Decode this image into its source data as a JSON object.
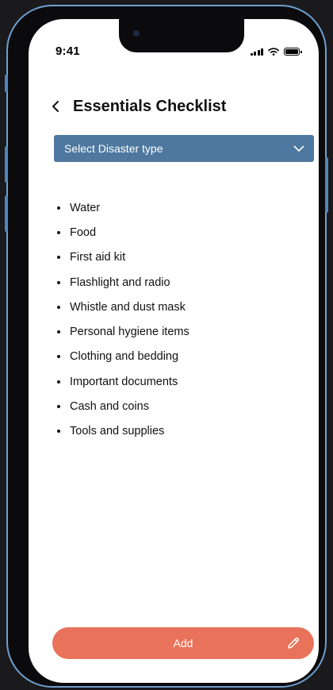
{
  "status_bar": {
    "time": "9:41"
  },
  "header": {
    "title": "Essentials Checklist"
  },
  "disaster_select": {
    "label": "Select Disaster type"
  },
  "checklist": {
    "items": [
      "Water",
      "Food",
      "First aid kit",
      "Flashlight and radio",
      "Whistle and dust mask",
      "Personal hygiene items",
      "Clothing and bedding",
      "Important documents",
      "Cash and coins",
      "Tools and supplies"
    ]
  },
  "add_button": {
    "label": "Add"
  },
  "icons": {
    "back": "chevron-left-icon",
    "select": "chevron-down-icon",
    "add": "pencil-icon",
    "status": [
      "signal-icon",
      "wifi-icon",
      "battery-icon"
    ]
  },
  "colors": {
    "select_background": "#4e789f",
    "add_button_background": "#e8735a",
    "device_frame": "#6f9fcf"
  }
}
